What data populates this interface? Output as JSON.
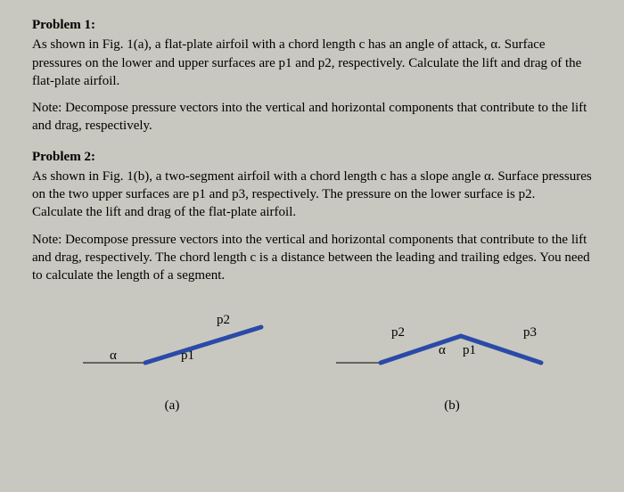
{
  "problem1": {
    "title": "Problem 1:",
    "body": "As shown in Fig. 1(a), a flat-plate airfoil with a chord length c has an angle of attack, α. Surface pressures on the lower and upper surfaces are p1 and p2, respectively. Calculate the lift and drag of the flat-plate airfoil.",
    "note": "Note: Decompose pressure vectors into the vertical and horizontal components that contribute to the lift and drag, respectively."
  },
  "problem2": {
    "title": "Problem 2:",
    "body": "As shown in Fig. 1(b), a two-segment airfoil with a chord length c has a slope angle α. Surface pressures on the two upper surfaces are p1 and p3, respectively.  The pressure on the lower surface is p2.",
    "body2": "Calculate the lift and drag of the flat-plate airfoil.",
    "note": "Note: Decompose pressure vectors into the vertical and horizontal components that contribute to the lift and drag, respectively.  The chord length c is a distance between the leading and trailing edges.  You need to calculate the length of a segment."
  },
  "figA": {
    "alpha": "α",
    "p1": "p1",
    "p2": "p2",
    "caption": "(a)"
  },
  "figB": {
    "alpha": "α",
    "p1": "p1",
    "p2": "p2",
    "p3": "p3",
    "caption": "(b)"
  }
}
